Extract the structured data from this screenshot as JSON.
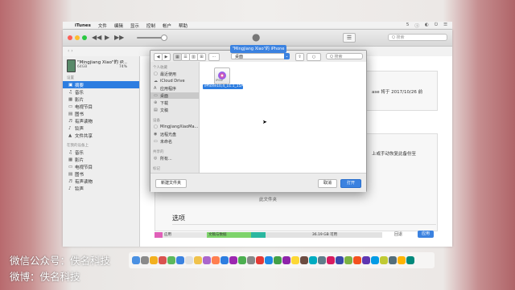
{
  "menubar": {
    "apple": "",
    "items": [
      "iTunes",
      "文件",
      "编辑",
      "显示",
      "控制",
      "帐户",
      "帮助"
    ],
    "right": [
      "5",
      "ⓘ",
      "◐",
      "⏻",
      "☰"
    ]
  },
  "toolbar": {
    "controls": [
      "◀◀",
      "▶",
      "▶▶"
    ],
    "list_icon": "☰",
    "search_placeholder": "Q 搜索",
    "device_pill": "\"Mingjiang Xiao\"的 iPhone"
  },
  "sidebar": {
    "device_name": "\"Mingjiang Xiao\"的 iP...",
    "device_capacity": "64GB",
    "device_battery": "74%",
    "settings_heading": "设置",
    "settings_items": [
      {
        "icon": "▣",
        "label": "摘要"
      },
      {
        "icon": "♫",
        "label": "音乐"
      },
      {
        "icon": "▦",
        "label": "影片"
      },
      {
        "icon": "▭",
        "label": "电视节目"
      },
      {
        "icon": "▤",
        "label": "图书"
      },
      {
        "icon": "♬",
        "label": "有声读物"
      },
      {
        "icon": "♪",
        "label": "铃声"
      },
      {
        "icon": "▲",
        "label": "文件共享"
      }
    ],
    "device_heading": "在我的设备上",
    "device_items": [
      {
        "icon": "♫",
        "label": "音乐"
      },
      {
        "icon": "▦",
        "label": "影片"
      },
      {
        "icon": "▭",
        "label": "电视节目"
      },
      {
        "icon": "▤",
        "label": "图书"
      },
      {
        "icon": "♬",
        "label": "有声读物"
      },
      {
        "icon": "♪",
        "label": "铃声"
      }
    ]
  },
  "content": {
    "partial_text_1": "ase 将于 2017/10/26 前",
    "partial_text_2": "上或手动恢复此备份至",
    "partial_text_3": "此文件夹",
    "options_title": "选项",
    "storage": [
      {
        "label": "应用",
        "color": "#e05fb8"
      },
      {
        "label": "文稿与数据",
        "color": "#7ed36b"
      },
      {
        "label": "",
        "color": "#2bb7a0"
      },
      {
        "label": "36.19 GB 可用",
        "color": "#e2e2e2"
      }
    ],
    "revert": "回退",
    "apply": "应用"
  },
  "dialog": {
    "toolbar_nav": [
      "◀",
      "▶"
    ],
    "view_buttons": [
      "▦",
      "☰",
      "▥",
      "⊞"
    ],
    "arrange": "⋯",
    "location": "桌面",
    "share": "⇪",
    "tags": "○",
    "search_placeholder": "Q 搜索",
    "favorites_heading": "个人收藏",
    "favorites": [
      {
        "icon": "▢",
        "label": "最近使用"
      },
      {
        "icon": "☁",
        "label": "iCloud Drive"
      },
      {
        "icon": "A",
        "label": "应用程序"
      },
      {
        "icon": "▭",
        "label": "桌面"
      },
      {
        "icon": "⊕",
        "label": "下载"
      },
      {
        "icon": "▤",
        "label": "文稿"
      }
    ],
    "devices_heading": "设备",
    "devices": [
      {
        "icon": "▢",
        "label": "MingjiangXiaoMa..."
      },
      {
        "icon": "◉",
        "label": "远程光盘"
      },
      {
        "icon": "▭",
        "label": "未命名"
      }
    ],
    "shared_heading": "共享的",
    "shared": [
      {
        "icon": "◎",
        "label": "所有..."
      }
    ],
    "tags_heading": "标记",
    "file_tag": "IPSW",
    "file_name": "iPhone10,4_11.1_15A403...tore.ipsw",
    "new_folder": "新建文件夹",
    "cancel": "取消",
    "open": "打开"
  },
  "dock": {
    "icons": [
      "#4a90e2",
      "#8a8a8a",
      "#f2b01e",
      "#d9534f",
      "#5cb85c",
      "#3b82e0",
      "#e0e0e0",
      "#f0c24b",
      "#aa66cc",
      "#ff7f50",
      "#2d7de0",
      "#9c27b0",
      "#4caf50",
      "#888888",
      "#e53935",
      "#1e88e5",
      "#43a047",
      "#8e24aa",
      "#fdd835",
      "#6d4c41",
      "#00acc1",
      "#607d8b",
      "#d81b60",
      "#3949ab",
      "#7cb342",
      "#f4511e",
      "#5e35b1",
      "#039be5",
      "#c0ca33",
      "#546e7a",
      "#ffb300",
      "#00897b"
    ]
  },
  "watermark": {
    "line1": "微信公众号：佚名科技",
    "line2": "微博：佚名科技"
  }
}
